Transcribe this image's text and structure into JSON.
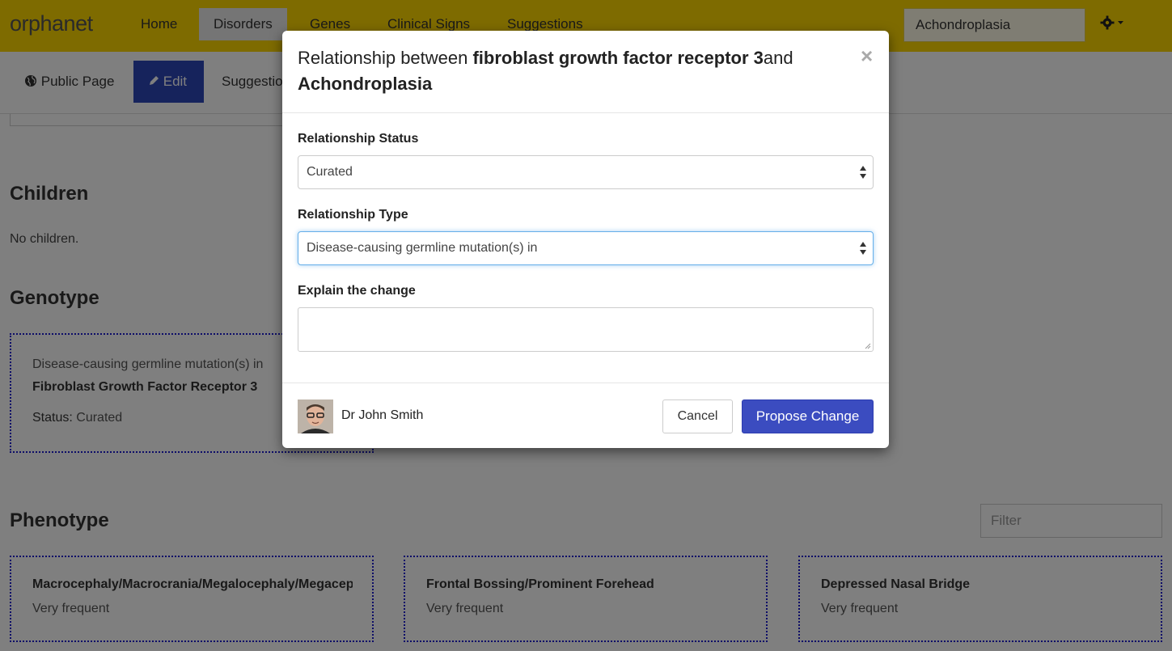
{
  "navbar": {
    "logo": "orphanet",
    "items": [
      "Home",
      "Disorders",
      "Genes",
      "Clinical Signs",
      "Suggestions"
    ],
    "active": "Disorders",
    "search_value": "Achondroplasia",
    "colors": {
      "bar": "#fdd600"
    }
  },
  "subnav": {
    "public_page": "Public Page",
    "edit": "Edit",
    "suggestions": "Suggestions"
  },
  "page": {
    "children_title": "Children",
    "children_text": "No children.",
    "genotype_title": "Genotype",
    "genotype": {
      "line1": "Disease-causing germline mutation(s) in",
      "gene": "Fibroblast Growth Factor Receptor 3",
      "status_label": "Status:",
      "status_value": "Curated"
    },
    "phenotype_title": "Phenotype",
    "filter_placeholder": "Filter",
    "phenotypes": [
      {
        "name": "Macrocephaly/Macrocrania/Megalocephaly/Megacephaly",
        "freq": "Very frequent"
      },
      {
        "name": "Frontal Bossing/Prominent Forehead",
        "freq": "Very frequent"
      },
      {
        "name": "Depressed Nasal Bridge",
        "freq": "Very frequent"
      }
    ]
  },
  "modal": {
    "title_prefix": "Relationship between ",
    "title_gene": "fibroblast growth factor receptor 3",
    "title_and": "and",
    "title_disorder": "Achondroplasia",
    "status_label": "Relationship Status",
    "status_value": "Curated",
    "type_label": "Relationship Type",
    "type_value": "Disease-causing germline mutation(s) in",
    "explain_label": "Explain the change",
    "explain_value": "",
    "user_name": "Dr John Smith",
    "cancel": "Cancel",
    "propose": "Propose Change",
    "colors": {
      "primary": "#3b4cc0",
      "edit": "#2d46b9"
    }
  }
}
